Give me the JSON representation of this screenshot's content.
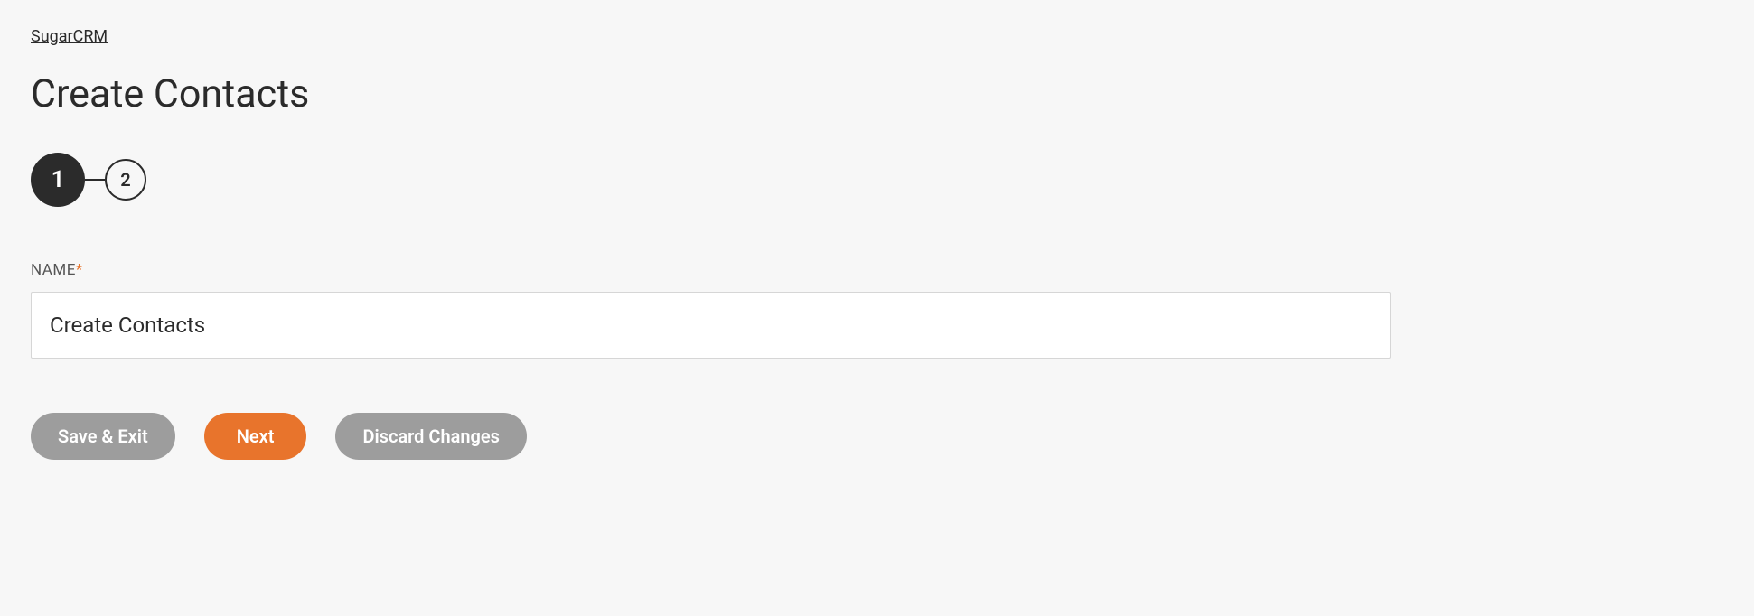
{
  "breadcrumb": {
    "label": "SugarCRM"
  },
  "page": {
    "title": "Create Contacts"
  },
  "stepper": {
    "steps": [
      {
        "number": "1",
        "active": true
      },
      {
        "number": "2",
        "active": false
      }
    ]
  },
  "form": {
    "name_field": {
      "label": "NAME",
      "required_mark": "*",
      "value": "Create Contacts"
    }
  },
  "buttons": {
    "save_exit": "Save & Exit",
    "next": "Next",
    "discard": "Discard Changes"
  }
}
